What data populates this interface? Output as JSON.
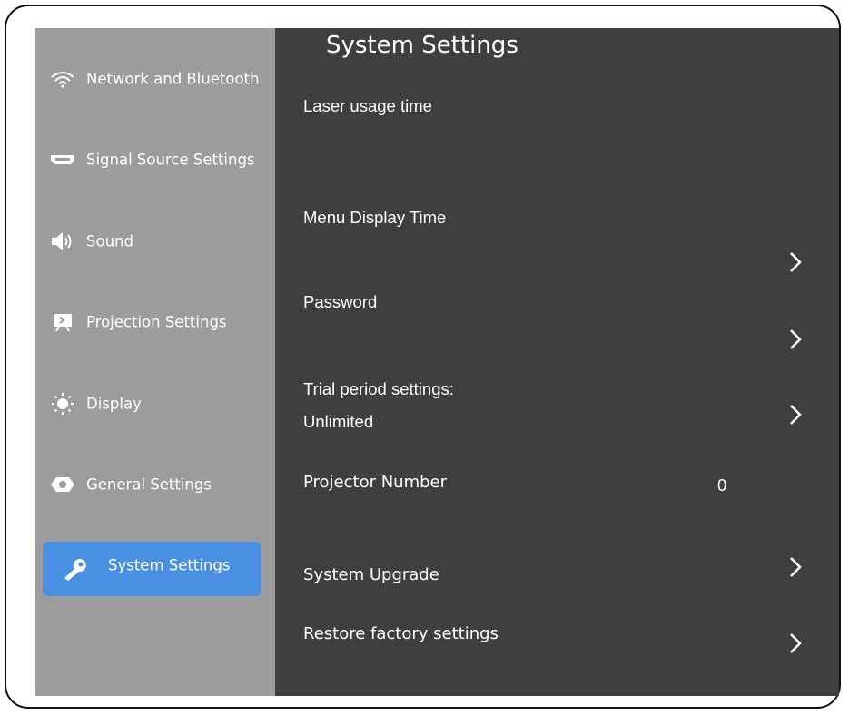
{
  "sidebar": {
    "items": [
      {
        "label": "Network and Bluetooth",
        "icon": "wifi-icon"
      },
      {
        "label": "Signal Source Settings",
        "icon": "hdmi-port-icon"
      },
      {
        "label": "Sound",
        "icon": "speaker-icon"
      },
      {
        "label": "Projection Settings",
        "icon": "projection-screen-icon"
      },
      {
        "label": "Display",
        "icon": "brightness-icon"
      },
      {
        "label": "General Settings",
        "icon": "eye-icon"
      },
      {
        "label": "System Settings",
        "icon": "wrench-icon",
        "active": true
      }
    ]
  },
  "main": {
    "title": "System Settings",
    "rows": {
      "laser_usage_time": {
        "label": "Laser usage time"
      },
      "menu_display_time": {
        "label": "Menu Display Time"
      },
      "password": {
        "label": "Password"
      },
      "trial_period": {
        "label": "Trial period settings:",
        "value": "Unlimited"
      },
      "projector_number": {
        "label": "Projector Number",
        "value": "0"
      },
      "system_upgrade": {
        "label": "System Upgrade"
      },
      "restore_factory": {
        "label": "Restore factory settings"
      }
    }
  },
  "colors": {
    "sidebar_bg": "#9c9c9c",
    "main_bg": "#3f3f3f",
    "active_item": "#4a90e2",
    "text": "#ffffff"
  }
}
